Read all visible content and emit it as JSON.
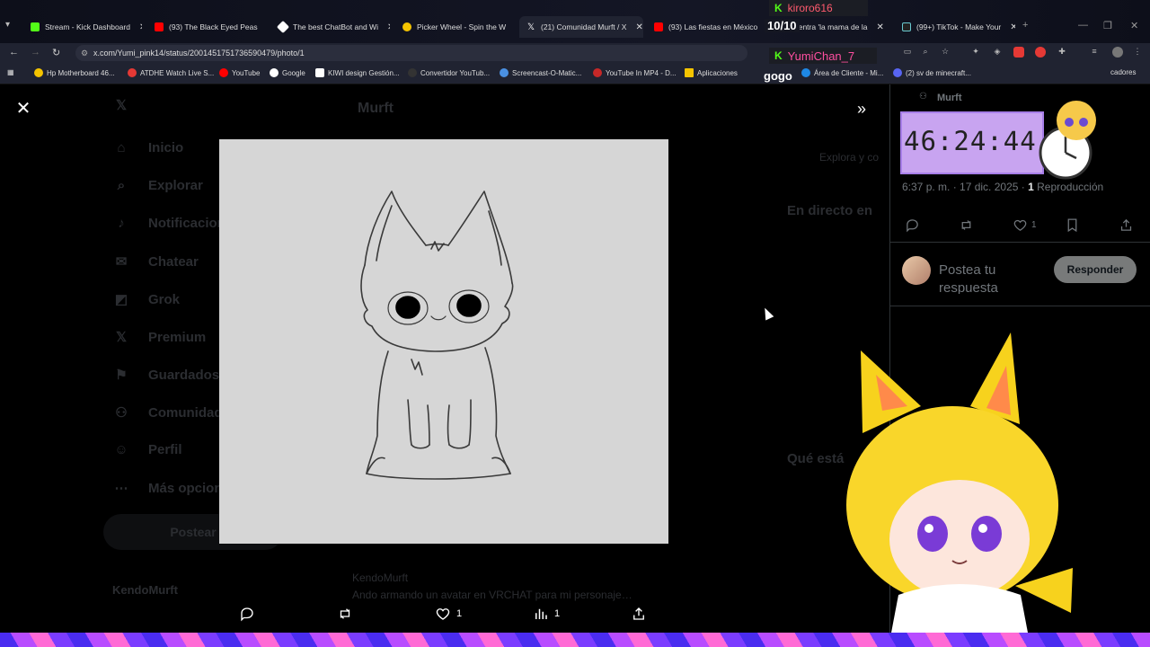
{
  "browser": {
    "tabs": [
      {
        "label": "Stream - Kick Dashboard",
        "color": "#53fc18"
      },
      {
        "label": "(93) The Black Eyed Peas",
        "color": "#ff0000"
      },
      {
        "label": "The best ChatBot and Wi",
        "color": "#ffffff"
      },
      {
        "label": "Picker Wheel - Spin the W",
        "color": "#f5c400"
      },
      {
        "label": "(21) Comunidad Murft / X",
        "color": "#ffffff"
      },
      {
        "label": "(93) Las fiestas en México",
        "color": "#ff0000"
      },
      {
        "label": "uentra 'la mama de la",
        "color": "#5865f2"
      },
      {
        "label": "(99+) TikTok - Make Your",
        "color": "#ffffff"
      }
    ],
    "url": "x.com/Yumi_pink14/status/2001451751736590479/photo/1",
    "bookmarks": [
      {
        "label": "Hp Motherboard 46...",
        "color": "#f5c400"
      },
      {
        "label": "ATDHE Watch Live S...",
        "color": "#e53935"
      },
      {
        "label": "YouTube",
        "color": "#ff0000"
      },
      {
        "label": "Google",
        "color": "#ffffff"
      },
      {
        "label": "KIWI design Gestión...",
        "color": "#ffffff"
      },
      {
        "label": "Convertidor YouTub...",
        "color": "#333333"
      },
      {
        "label": "Screencast-O-Matic...",
        "color": "#4a90e2"
      },
      {
        "label": "YouTube In MP4 - D...",
        "color": "#c62828"
      },
      {
        "label": "Aplicaciones",
        "color": "#f5c400"
      },
      {
        "label": "Área de Cliente - Mi...",
        "color": "#1e88e5"
      },
      {
        "label": "(2) sv de minecraft...",
        "color": "#5865f2"
      },
      {
        "label": "cadores",
        "color": "#888888"
      }
    ]
  },
  "overlay": {
    "kick_user_1": "kiroro616",
    "score": "10/10",
    "kick_user_2": "YumiChan_7",
    "gogo": "gogo",
    "timer": "46:24:44"
  },
  "left_nav": [
    {
      "label": "Inicio",
      "icon": "home-icon"
    },
    {
      "label": "Explorar",
      "icon": "search-icon"
    },
    {
      "label": "Notificaciones",
      "icon": "bell-icon"
    },
    {
      "label": "Chatear",
      "icon": "mail-icon"
    },
    {
      "label": "Grok",
      "icon": "grok-icon"
    },
    {
      "label": "Premium",
      "icon": "x-logo-icon"
    },
    {
      "label": "Guardados",
      "icon": "bookmark-icon"
    },
    {
      "label": "Comunidades",
      "icon": "people-icon"
    },
    {
      "label": "Perfil",
      "icon": "user-icon"
    },
    {
      "label": "Más opciones",
      "icon": "more-icon"
    }
  ],
  "post_button_label": "Postear",
  "dim_profile_name": "KendoMurft",
  "center": {
    "header": "Murft",
    "reply_name": "KendoMurft",
    "reply_text": "Ando armando un avatar en VRCHAT para mi personaje…"
  },
  "right_dim": {
    "search_placeholder": "Explora y co",
    "live_heading": "En directo en",
    "trending_heading": "Qué está"
  },
  "photo": {
    "alt": "Sketch of a fluffy cat character"
  },
  "viewer_actions": {
    "likes": "1",
    "views": "1"
  },
  "panel": {
    "author": "Murft",
    "time": "6:37 p. m. · 17 dic. 2025 ·",
    "reproductions_count": "1",
    "reproductions_label": "Reproducción",
    "likes": "1",
    "reply_placeholder": "Postea tu respuesta",
    "reply_button": "Responder"
  }
}
